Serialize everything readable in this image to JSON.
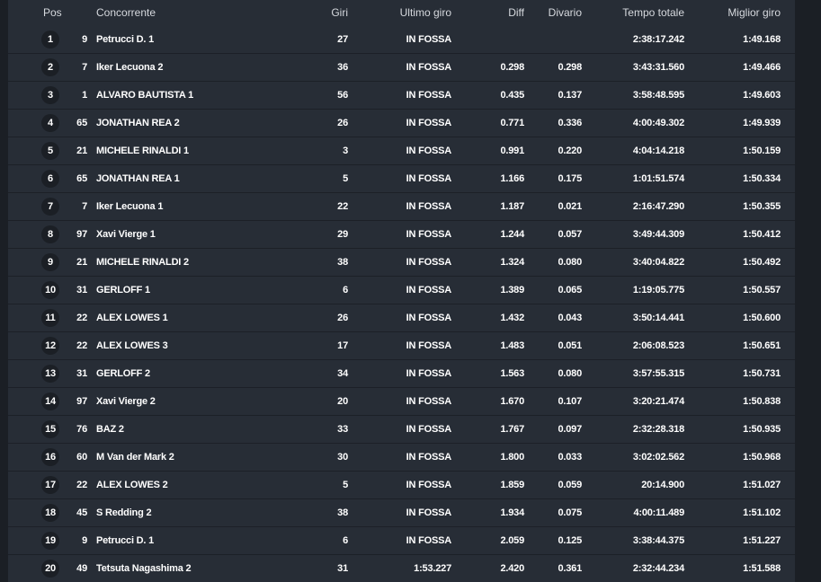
{
  "header": {
    "pos": "Pos",
    "competitor": "Concorrente",
    "laps": "Giri",
    "last_lap": "Ultimo giro",
    "diff": "Diff",
    "gap": "Divario",
    "total_time": "Tempo totale",
    "best_lap": "Miglior giro"
  },
  "rows": [
    {
      "pos": "1",
      "num": "9",
      "name": "Petrucci D. 1",
      "laps": "27",
      "last": "IN FOSSA",
      "diff": "",
      "gap": "",
      "total": "2:38:17.242",
      "best": "1:49.168"
    },
    {
      "pos": "2",
      "num": "7",
      "name": "Iker Lecuona 2",
      "laps": "36",
      "last": "IN FOSSA",
      "diff": "0.298",
      "gap": "0.298",
      "total": "3:43:31.560",
      "best": "1:49.466"
    },
    {
      "pos": "3",
      "num": "1",
      "name": "ALVARO BAUTISTA 1",
      "laps": "56",
      "last": "IN FOSSA",
      "diff": "0.435",
      "gap": "0.137",
      "total": "3:58:48.595",
      "best": "1:49.603"
    },
    {
      "pos": "4",
      "num": "65",
      "name": "JONATHAN REA 2",
      "laps": "26",
      "last": "IN FOSSA",
      "diff": "0.771",
      "gap": "0.336",
      "total": "4:00:49.302",
      "best": "1:49.939"
    },
    {
      "pos": "5",
      "num": "21",
      "name": "MICHELE RINALDI 1",
      "laps": "3",
      "last": "IN FOSSA",
      "diff": "0.991",
      "gap": "0.220",
      "total": "4:04:14.218",
      "best": "1:50.159"
    },
    {
      "pos": "6",
      "num": "65",
      "name": "JONATHAN REA 1",
      "laps": "5",
      "last": "IN FOSSA",
      "diff": "1.166",
      "gap": "0.175",
      "total": "1:01:51.574",
      "best": "1:50.334"
    },
    {
      "pos": "7",
      "num": "7",
      "name": "Iker Lecuona 1",
      "laps": "22",
      "last": "IN FOSSA",
      "diff": "1.187",
      "gap": "0.021",
      "total": "2:16:47.290",
      "best": "1:50.355"
    },
    {
      "pos": "8",
      "num": "97",
      "name": "Xavi Vierge 1",
      "laps": "29",
      "last": "IN FOSSA",
      "diff": "1.244",
      "gap": "0.057",
      "total": "3:49:44.309",
      "best": "1:50.412"
    },
    {
      "pos": "9",
      "num": "21",
      "name": "MICHELE RINALDI 2",
      "laps": "38",
      "last": "IN FOSSA",
      "diff": "1.324",
      "gap": "0.080",
      "total": "3:40:04.822",
      "best": "1:50.492"
    },
    {
      "pos": "10",
      "num": "31",
      "name": "GERLOFF 1",
      "laps": "6",
      "last": "IN FOSSA",
      "diff": "1.389",
      "gap": "0.065",
      "total": "1:19:05.775",
      "best": "1:50.557"
    },
    {
      "pos": "11",
      "num": "22",
      "name": "ALEX LOWES 1",
      "laps": "26",
      "last": "IN FOSSA",
      "diff": "1.432",
      "gap": "0.043",
      "total": "3:50:14.441",
      "best": "1:50.600"
    },
    {
      "pos": "12",
      "num": "22",
      "name": "ALEX LOWES 3",
      "laps": "17",
      "last": "IN FOSSA",
      "diff": "1.483",
      "gap": "0.051",
      "total": "2:06:08.523",
      "best": "1:50.651"
    },
    {
      "pos": "13",
      "num": "31",
      "name": "GERLOFF 2",
      "laps": "34",
      "last": "IN FOSSA",
      "diff": "1.563",
      "gap": "0.080",
      "total": "3:57:55.315",
      "best": "1:50.731"
    },
    {
      "pos": "14",
      "num": "97",
      "name": "Xavi Vierge 2",
      "laps": "20",
      "last": "IN FOSSA",
      "diff": "1.670",
      "gap": "0.107",
      "total": "3:20:21.474",
      "best": "1:50.838"
    },
    {
      "pos": "15",
      "num": "76",
      "name": "BAZ 2",
      "laps": "33",
      "last": "IN FOSSA",
      "diff": "1.767",
      "gap": "0.097",
      "total": "2:32:28.318",
      "best": "1:50.935"
    },
    {
      "pos": "16",
      "num": "60",
      "name": "M Van der Mark 2",
      "laps": "30",
      "last": "IN FOSSA",
      "diff": "1.800",
      "gap": "0.033",
      "total": "3:02:02.562",
      "best": "1:50.968"
    },
    {
      "pos": "17",
      "num": "22",
      "name": "ALEX LOWES 2",
      "laps": "5",
      "last": "IN FOSSA",
      "diff": "1.859",
      "gap": "0.059",
      "total": "20:14.900",
      "best": "1:51.027"
    },
    {
      "pos": "18",
      "num": "45",
      "name": "S Redding 2",
      "laps": "38",
      "last": "IN FOSSA",
      "diff": "1.934",
      "gap": "0.075",
      "total": "4:00:11.489",
      "best": "1:51.102"
    },
    {
      "pos": "19",
      "num": "9",
      "name": "Petrucci D. 1",
      "laps": "6",
      "last": "IN FOSSA",
      "diff": "2.059",
      "gap": "0.125",
      "total": "3:38:44.375",
      "best": "1:51.227"
    },
    {
      "pos": "20",
      "num": "49",
      "name": "Tetsuta Nagashima 2",
      "laps": "31",
      "last": "1:53.227",
      "diff": "2.420",
      "gap": "0.361",
      "total": "2:32:44.234",
      "best": "1:51.588"
    }
  ]
}
